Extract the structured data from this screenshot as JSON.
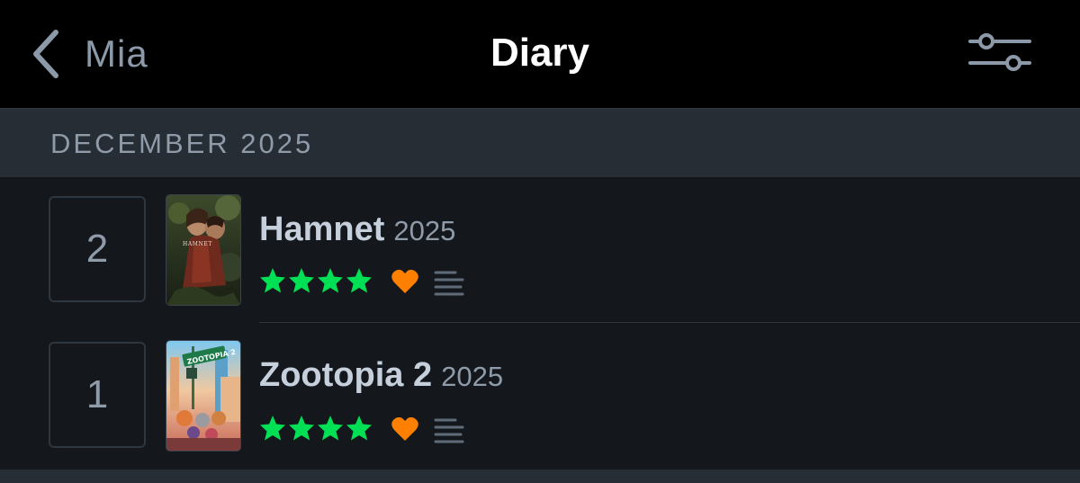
{
  "header": {
    "back_label": "Mia",
    "title": "Diary"
  },
  "month": {
    "label": "DECEMBER 2025"
  },
  "entries": [
    {
      "day": "2",
      "title": "Hamnet",
      "year": "2025",
      "rating_stars": 4,
      "liked": true,
      "has_review": true,
      "poster_text": "HAMNET"
    },
    {
      "day": "1",
      "title": "Zootopia 2",
      "year": "2025",
      "rating_stars": 4,
      "liked": true,
      "has_review": true,
      "poster_text": "ZOOTOPIA 2"
    }
  ],
  "colors": {
    "star": "#00e054",
    "heart": "#ff8000",
    "header_bg": "#000000",
    "band_bg": "#262d35",
    "page_bg": "#14181c"
  },
  "icons": {
    "back": "chevron-left-icon",
    "filter": "sliders-icon",
    "star": "star-icon",
    "heart": "heart-icon",
    "review": "review-lines-icon"
  }
}
